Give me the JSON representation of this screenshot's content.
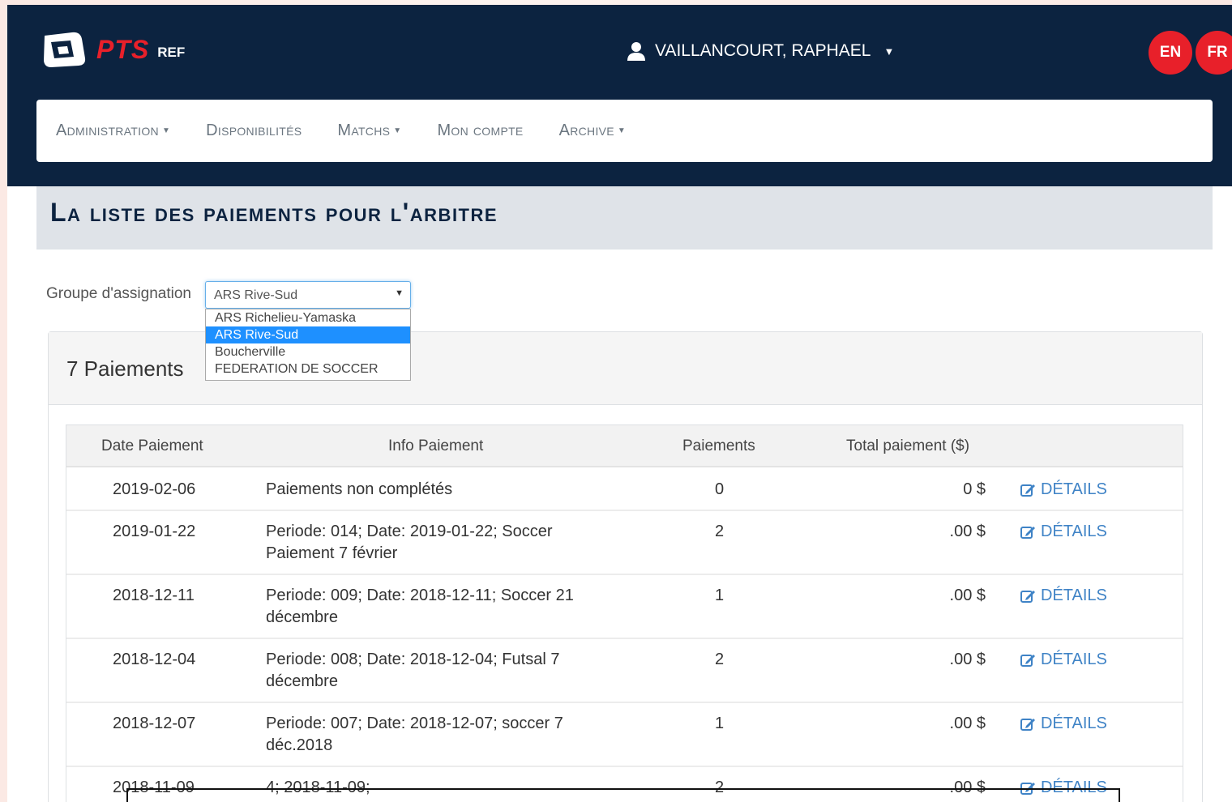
{
  "header": {
    "logo_text": "PTS",
    "logo_sub": "REF",
    "user_name": "VAILLANCOURT, RAPHAEL",
    "lang_en": "EN",
    "lang_fr": "FR"
  },
  "nav": {
    "items": [
      {
        "label": "Administration",
        "dropdown": true
      },
      {
        "label": "Disponibilités",
        "dropdown": false
      },
      {
        "label": "Matchs",
        "dropdown": true
      },
      {
        "label": "Mon compte",
        "dropdown": false
      },
      {
        "label": "Archive",
        "dropdown": true
      }
    ]
  },
  "page": {
    "title": "La liste des paiements pour l'arbitre"
  },
  "filter": {
    "label": "Groupe d'assignation",
    "selected": "ARS Rive-Sud",
    "options": [
      "ARS Richelieu-Yamaska",
      "ARS Rive-Sud",
      "Boucherville",
      "FEDERATION DE SOCCER"
    ]
  },
  "panel": {
    "count_label": "7 Paiements"
  },
  "table": {
    "headers": [
      "Date Paiement",
      "Info Paiement",
      "Paiements",
      "Total paiement ($)"
    ],
    "details_label": "DÉTAILS",
    "rows": [
      {
        "date": "2019-02-06",
        "info": "Paiements non complétés",
        "count": "0",
        "total": "0 $"
      },
      {
        "date": "2019-01-22",
        "info": "Periode: 014; Date: 2019-01-22; Soccer Paiement 7 février",
        "count": "2",
        "total": ".00 $"
      },
      {
        "date": "2018-12-11",
        "info": "Periode: 009; Date: 2018-12-11; Soccer 21 décembre",
        "count": "1",
        "total": ".00 $"
      },
      {
        "date": "2018-12-04",
        "info": "Periode: 008; Date: 2018-12-04; Futsal 7 décembre",
        "count": "2",
        "total": ".00 $"
      },
      {
        "date": "2018-12-07",
        "info": "Periode: 007; Date: 2018-12-07; soccer 7 déc.2018",
        "count": "1",
        "total": ".00 $"
      },
      {
        "date": "2018-11-09",
        "info": "4; 2018-11-09;",
        "count": "2",
        "total": ".00 $"
      }
    ]
  },
  "colors": {
    "navy": "#0c2340",
    "brand_red": "#e8202a",
    "link_blue": "#3f83c6",
    "select_highlight": "#1e90ff"
  }
}
